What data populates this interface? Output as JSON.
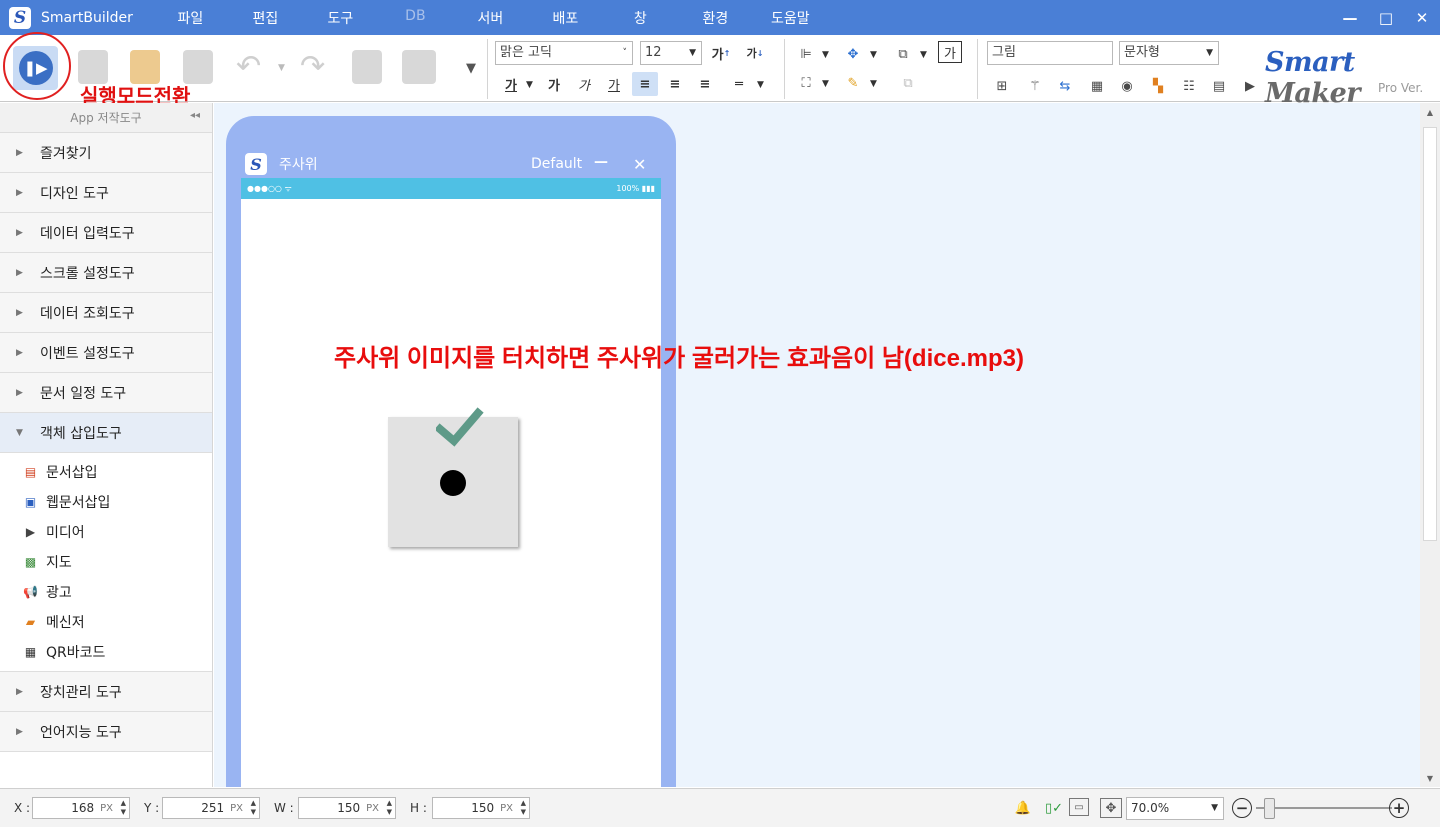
{
  "app": {
    "name": "SmartBuilder",
    "logo_letter": "S"
  },
  "menu": [
    {
      "label": "파일",
      "disabled": false
    },
    {
      "label": "편집",
      "disabled": false
    },
    {
      "label": "도구",
      "disabled": false
    },
    {
      "label": "DB",
      "disabled": true
    },
    {
      "label": "서버",
      "disabled": false
    },
    {
      "label": "배포",
      "disabled": false
    },
    {
      "label": "창",
      "disabled": false
    },
    {
      "label": "환경",
      "disabled": false
    },
    {
      "label": "도움말",
      "disabled": false
    }
  ],
  "window_controls": {
    "minimize": "—",
    "maximize": "□",
    "close": "✕"
  },
  "toolbar": {
    "run_annotation": "실행모드전환",
    "font_family": "맑은 고딕",
    "font_size": "12",
    "text_fmt": {
      "grow": "가",
      "shrink": "가",
      "color": "가",
      "bold": "가",
      "italic": "가",
      "underline": "가",
      "box": "가"
    },
    "object_type": "그림",
    "text_type": "문자형"
  },
  "brand": {
    "smart": "Smart",
    "maker": "Maker",
    "sub": "Pro Ver."
  },
  "sidebar": {
    "header": "App 저작도구",
    "categories_top": [
      "즐겨찾기",
      "디자인 도구",
      "데이터 입력도구",
      "스크롤 설정도구",
      "데이터 조회도구",
      "이벤트 설정도구",
      "문서 일정 도구"
    ],
    "open_category": "객체 삽입도구",
    "open_items": [
      {
        "label": "문서삽입",
        "icon": "document-insert-icon"
      },
      {
        "label": "웹문서삽입",
        "icon": "web-document-icon"
      },
      {
        "label": "미디어",
        "icon": "media-icon"
      },
      {
        "label": "지도",
        "icon": "map-icon"
      },
      {
        "label": "광고",
        "icon": "megaphone-icon"
      },
      {
        "label": "메신저",
        "icon": "messenger-icon"
      },
      {
        "label": "QR바코드",
        "icon": "qr-code-icon"
      }
    ],
    "categories_bottom": [
      "장치관리 도구",
      "언어지능 도구"
    ]
  },
  "device": {
    "logo_letter": "S",
    "window_title": "주사위",
    "profile": "Default",
    "minimize": "—",
    "close": "✕",
    "status_left": "●●●○○ ᯤ",
    "status_right": "100% ▮▮▮"
  },
  "annotation": "주사위 이미지를 터치하면 주사위가 굴러가는 효과음이 남(dice.mp3)",
  "statusbar": {
    "x_label": "X :",
    "x_value": "168",
    "x_unit": "PX",
    "y_label": "Y :",
    "y_value": "251",
    "y_unit": "PX",
    "w_label": "W :",
    "w_value": "150",
    "w_unit": "PX",
    "h_label": "H :",
    "h_value": "150",
    "h_unit": "PX",
    "zoom": "70.0%",
    "zoom_minus": "−",
    "zoom_plus": "+"
  },
  "colors": {
    "titlebar": "#4a7fd6",
    "device_frame": "#99b4f2",
    "statusbar_blue": "#4fc0e4",
    "annotation_red": "#e80d0d",
    "canvas_bg": "#ecf4fd"
  }
}
